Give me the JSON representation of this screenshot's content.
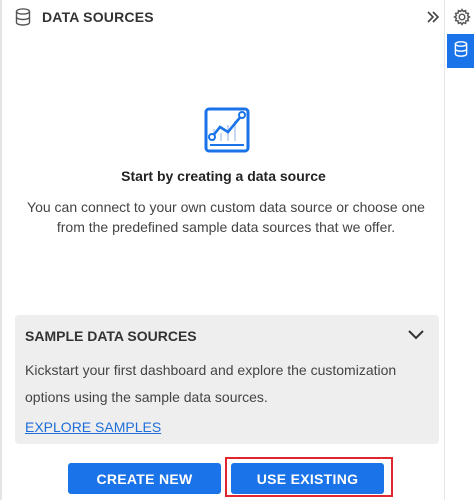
{
  "header": {
    "title": "DATA SOURCES"
  },
  "empty_state": {
    "title": "Start by creating a data source",
    "description": "You can connect to your own custom data source or choose one from the predefined sample data sources that we offer."
  },
  "sample_section": {
    "title": "SAMPLE DATA SOURCES",
    "description": "Kickstart your first dashboard and explore the customization options using the sample data sources.",
    "link_label": "EXPLORE SAMPLES"
  },
  "actions": {
    "create_label": "CREATE NEW",
    "existing_label": "USE EXISTING"
  },
  "icons": {
    "header": "database-icon",
    "collapse": "double-chevron-right-icon",
    "hero": "line-chart-icon",
    "chevron": "chevron-down-icon",
    "rail_settings": "gear-icon",
    "rail_data": "database-icon"
  },
  "colors": {
    "primary": "#1a73e8",
    "highlight_outline": "#e0262e",
    "card_background": "#eeeeee",
    "link": "#1e6fd9"
  }
}
